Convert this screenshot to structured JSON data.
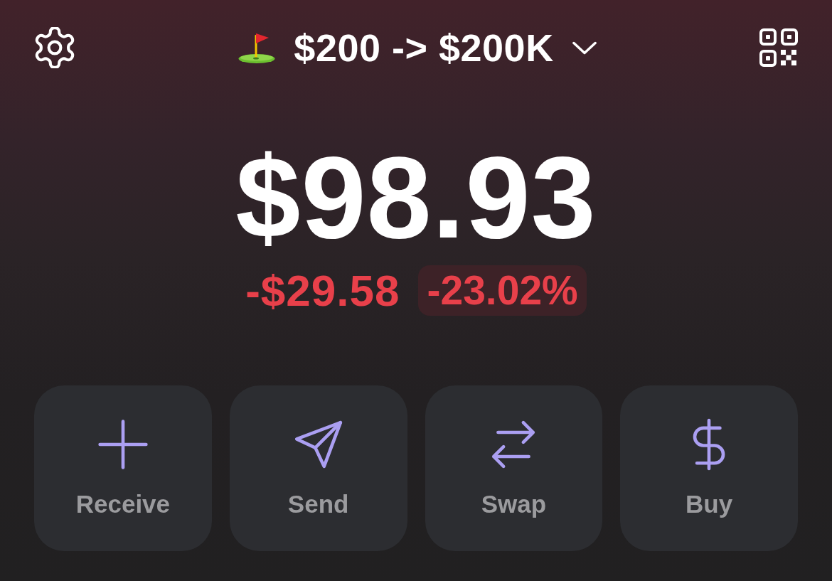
{
  "header": {
    "account_name": "$200 -> $200K"
  },
  "balance": "$98.93",
  "change": {
    "amount": "-$29.58",
    "percent": "-23.02%",
    "negative": true
  },
  "actions": [
    {
      "label": "Receive"
    },
    {
      "label": "Send"
    },
    {
      "label": "Swap"
    },
    {
      "label": "Buy"
    }
  ]
}
